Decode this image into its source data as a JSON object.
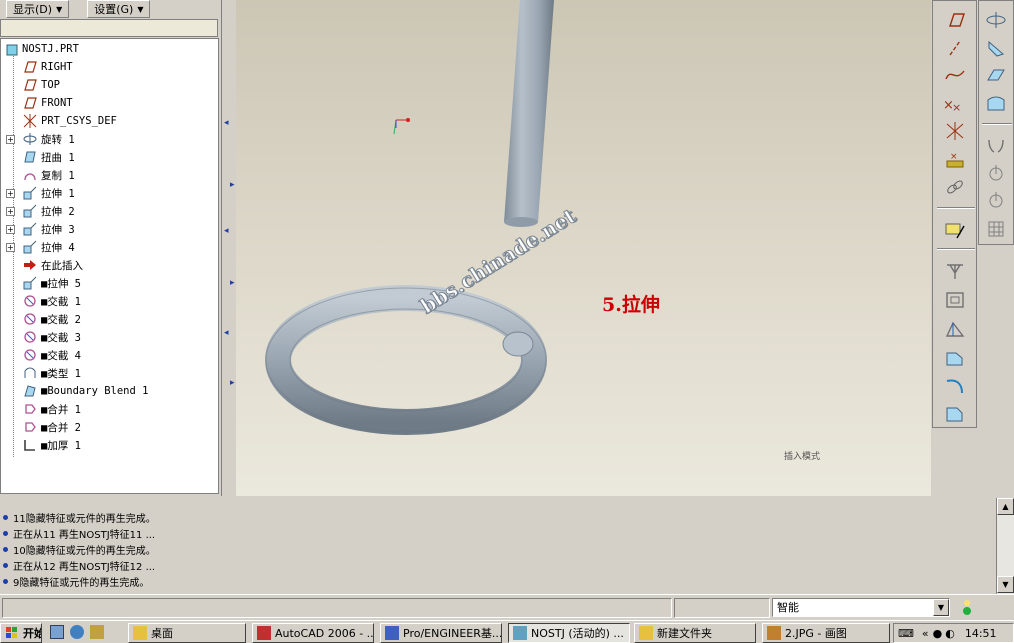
{
  "menu": {
    "display": "显示(D)",
    "settings": "设置(G)"
  },
  "tree": [
    {
      "label": "NOSTJ.PRT",
      "icon": "part-icon",
      "expander": false,
      "root": true
    },
    {
      "label": "RIGHT",
      "icon": "datum-plane-icon",
      "expander": false
    },
    {
      "label": "TOP",
      "icon": "datum-plane-icon",
      "expander": false
    },
    {
      "label": "FRONT",
      "icon": "datum-plane-icon",
      "expander": false
    },
    {
      "label": "PRT_CSYS_DEF",
      "icon": "csys-icon",
      "expander": false
    },
    {
      "label": "旋转 1",
      "icon": "revolve-icon",
      "expander": true
    },
    {
      "label": "扭曲 1",
      "icon": "warp-icon",
      "expander": false
    },
    {
      "label": "复制 1",
      "icon": "copy-surface-icon",
      "expander": false
    },
    {
      "label": "拉伸 1",
      "icon": "extrude-icon",
      "expander": true
    },
    {
      "label": "拉伸 2",
      "icon": "extrude-icon",
      "expander": true
    },
    {
      "label": "拉伸 3",
      "icon": "extrude-icon",
      "expander": true
    },
    {
      "label": "拉伸 4",
      "icon": "extrude-icon",
      "expander": true
    },
    {
      "label": "在此插入",
      "icon": "insert-here-arrow-icon",
      "expander": false
    },
    {
      "label": "■拉伸 5",
      "icon": "extrude-icon",
      "expander": false
    },
    {
      "label": "■交截 1",
      "icon": "intersect-icon",
      "expander": false
    },
    {
      "label": "■交截 2",
      "icon": "intersect-icon",
      "expander": false
    },
    {
      "label": "■交截 3",
      "icon": "intersect-icon",
      "expander": false
    },
    {
      "label": "■交截 4",
      "icon": "intersect-icon",
      "expander": false
    },
    {
      "label": "■类型 1",
      "icon": "type-icon",
      "expander": false
    },
    {
      "label": "■Boundary Blend 1",
      "icon": "boundary-blend-icon",
      "expander": false
    },
    {
      "label": "■合并 1",
      "icon": "merge-icon",
      "expander": false
    },
    {
      "label": "■合并 2",
      "icon": "merge-icon",
      "expander": false
    },
    {
      "label": "■加厚 1",
      "icon": "thicken-icon",
      "expander": false
    }
  ],
  "viewport": {
    "annotation": "5.拉伸",
    "watermark": "bbs.chinade.net",
    "mode_label": "插入模式"
  },
  "messages": [
    "11隐藏特征或元件的再生完成。",
    "正在从11 再生NOSTJ特征11 ...",
    "10隐藏特征或元件的再生完成。",
    "正在从12 再生NOSTJ特征12 ...",
    "9隐藏特征或元件的再生完成。"
  ],
  "status": {
    "filter_value": "智能"
  },
  "taskbar": {
    "start": "开始",
    "items": [
      {
        "label": "桌面",
        "active": false
      },
      {
        "label": "AutoCAD 2006 - ...",
        "active": false
      },
      {
        "label": "Pro/ENGINEER基...",
        "active": false
      },
      {
        "label": "NOSTJ (活动的) ...",
        "active": true
      },
      {
        "label": "新建文件夹",
        "active": false
      },
      {
        "label": "2.JPG - 画图",
        "active": false
      }
    ],
    "clock": "14:51"
  },
  "colors": {
    "accent_red": "#cc0000",
    "message_dot": "#1a3fb0",
    "model_gray": "#9aa6b2"
  }
}
